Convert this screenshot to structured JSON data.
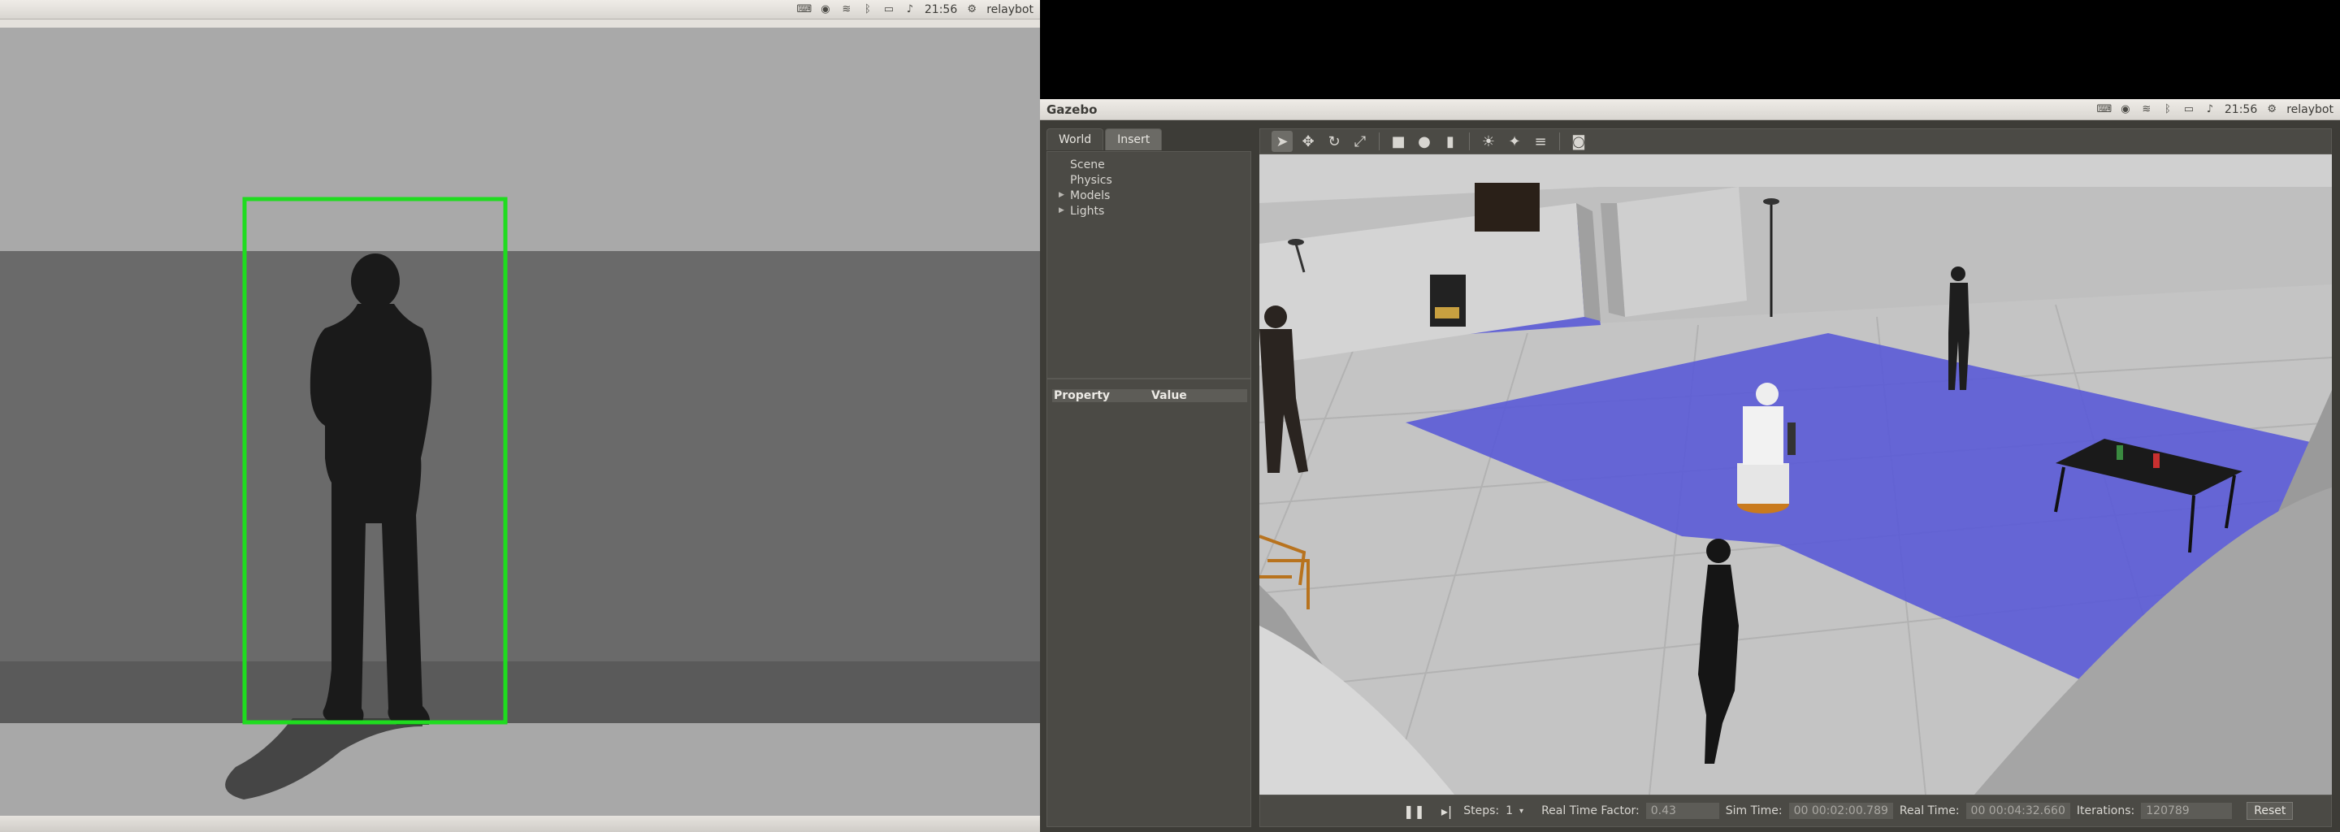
{
  "left_panel": {
    "tray": {
      "time": "21:56",
      "user": "relaybot",
      "icons": [
        "keyboard-icon",
        "chrome-icon",
        "wifi-icon",
        "bluetooth-icon",
        "battery-icon",
        "volume-icon",
        "gear-icon"
      ]
    }
  },
  "right_panel": {
    "app_title": "Gazebo",
    "tray": {
      "time": "21:56",
      "user": "relaybot"
    },
    "sidebar": {
      "tabs": [
        "World",
        "Insert"
      ],
      "tree": [
        "Scene",
        "Physics",
        "Models",
        "Lights"
      ],
      "property_header": "Property",
      "value_header": "Value"
    },
    "toolbar": [
      "select-arrow-icon",
      "translate-icon",
      "rotate-icon",
      "scale-icon",
      "box-icon",
      "sphere-icon",
      "cylinder-icon",
      "point-light-icon",
      "spot-light-icon",
      "directional-light-icon",
      "camera-icon"
    ],
    "status": {
      "steps_label": "Steps:",
      "steps_value": "1",
      "rtf_label": "Real Time Factor:",
      "rtf_value": "0.43",
      "sim_time_label": "Sim Time:",
      "sim_time_value": "00 00:02:00.789",
      "real_time_label": "Real Time:",
      "real_time_value": "00 00:04:32.660",
      "iterations_label": "Iterations:",
      "iterations_value": "120789",
      "reset_label": "Reset"
    }
  },
  "colors": {
    "detection_box": "#1fdc1f",
    "floor_highlight": "#5555d8",
    "panel_bg": "#3d3c37"
  }
}
